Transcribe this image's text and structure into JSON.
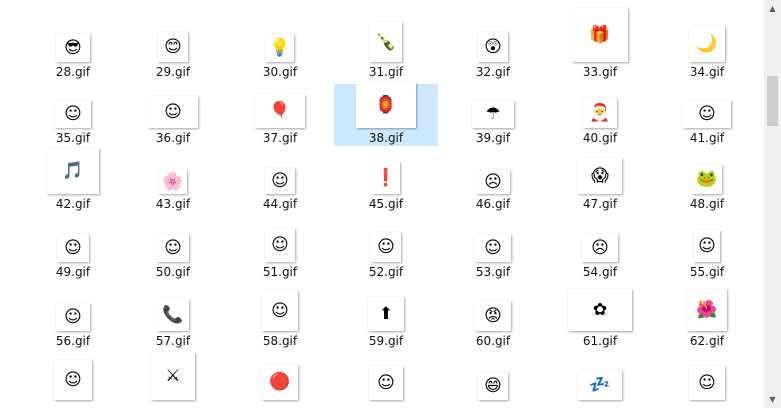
{
  "files": [
    {
      "name": "28.gif",
      "icon": "sunglasses-face",
      "glyph": "😎",
      "bg": "#ffffff"
    },
    {
      "name": "29.gif",
      "icon": "blush-face",
      "glyph": "😊",
      "bg": "#ffffff"
    },
    {
      "name": "30.gif",
      "icon": "lightbulb",
      "glyph": "💡",
      "bg": "#ffffff"
    },
    {
      "name": "31.gif",
      "icon": "bottle",
      "glyph": "🍾",
      "bg": "#ffffff"
    },
    {
      "name": "32.gif",
      "icon": "surprised-face",
      "glyph": "😲",
      "bg": "#ffffff"
    },
    {
      "name": "33.gif",
      "icon": "gift-box",
      "glyph": "🎁",
      "bg": "#ffffff"
    },
    {
      "name": "34.gif",
      "icon": "moon",
      "glyph": "🌙",
      "bg": "#ffffff"
    },
    {
      "name": "35.gif",
      "icon": "white-blob",
      "glyph": "☺",
      "bg": "#ffffff"
    },
    {
      "name": "36.gif",
      "icon": "thinking-blob",
      "glyph": "☺",
      "bg": "#ffffff"
    },
    {
      "name": "37.gif",
      "icon": "balloon-blob",
      "glyph": "🎈",
      "bg": "#ffffff"
    },
    {
      "name": "38.gif",
      "icon": "couplet-blob",
      "glyph": "🏮",
      "bg": "#ffffff"
    },
    {
      "name": "39.gif",
      "icon": "umbrella-blob",
      "glyph": "☂",
      "bg": "#ffffff"
    },
    {
      "name": "40.gif",
      "icon": "santa-blob",
      "glyph": "🎅",
      "bg": "#ffffff"
    },
    {
      "name": "41.gif",
      "icon": "green-hat-blob",
      "glyph": "☺",
      "bg": "#ffffff"
    },
    {
      "name": "42.gif",
      "icon": "music-blob",
      "glyph": "🎵",
      "bg": "#ffffff"
    },
    {
      "name": "43.gif",
      "icon": "flower-blob",
      "glyph": "🌸",
      "bg": "#ffffff"
    },
    {
      "name": "44.gif",
      "icon": "red-blob",
      "glyph": "☺",
      "bg": "#ffffff"
    },
    {
      "name": "45.gif",
      "icon": "exclaim-blob",
      "glyph": "❗",
      "bg": "#ffffff"
    },
    {
      "name": "46.gif",
      "icon": "crying-blob",
      "glyph": "☹",
      "bg": "#ffffff"
    },
    {
      "name": "47.gif",
      "icon": "shock-blob",
      "glyph": "😱",
      "bg": "#ffffff"
    },
    {
      "name": "48.gif",
      "icon": "green-blob",
      "glyph": "🐸",
      "bg": "#ffffff"
    },
    {
      "name": "49.gif",
      "icon": "blob",
      "glyph": "☺",
      "bg": "#ffffff"
    },
    {
      "name": "50.gif",
      "icon": "blob",
      "glyph": "☺",
      "bg": "#ffffff"
    },
    {
      "name": "51.gif",
      "icon": "blob",
      "glyph": "☺",
      "bg": "#ffffff"
    },
    {
      "name": "52.gif",
      "icon": "blob",
      "glyph": "☺",
      "bg": "#ffffff"
    },
    {
      "name": "53.gif",
      "icon": "blob",
      "glyph": "☺",
      "bg": "#ffffff"
    },
    {
      "name": "54.gif",
      "icon": "angry-blob",
      "glyph": "☹",
      "bg": "#ffffff"
    },
    {
      "name": "55.gif",
      "icon": "blob",
      "glyph": "☺",
      "bg": "#ffffff"
    },
    {
      "name": "56.gif",
      "icon": "blob",
      "glyph": "☺",
      "bg": "#ffffff"
    },
    {
      "name": "57.gif",
      "icon": "call-blob",
      "glyph": "📞",
      "bg": "#ffffff"
    },
    {
      "name": "58.gif",
      "icon": "blob",
      "glyph": "☺",
      "bg": "#ffffff"
    },
    {
      "name": "59.gif",
      "icon": "arrow-blob",
      "glyph": "⬆",
      "bg": "#ffffff"
    },
    {
      "name": "60.gif",
      "icon": "red-angry-blob",
      "glyph": "😡",
      "bg": "#ffffff"
    },
    {
      "name": "61.gif",
      "icon": "pink-blob",
      "glyph": "✿",
      "bg": "#ffffff"
    },
    {
      "name": "62.gif",
      "icon": "pink-flower-blob",
      "glyph": "🌺",
      "bg": "#ffffff"
    },
    {
      "name": "",
      "icon": "blob",
      "glyph": "☺",
      "bg": "#ffffff"
    },
    {
      "name": "",
      "icon": "sword-blob",
      "glyph": "⚔",
      "bg": "#ffffff"
    },
    {
      "name": "",
      "icon": "red-ball",
      "glyph": "🔴",
      "bg": "#ffffff"
    },
    {
      "name": "",
      "icon": "blob",
      "glyph": "☺",
      "bg": "#ffffff"
    },
    {
      "name": "",
      "icon": "yellow-face",
      "glyph": "😄",
      "bg": "#ffffff"
    },
    {
      "name": "",
      "icon": "sleepy-blob",
      "glyph": "💤",
      "bg": "#ffffff"
    },
    {
      "name": "",
      "icon": "desk-blob",
      "glyph": "☺",
      "bg": "#ffffff"
    }
  ],
  "selected_file": "38.gif",
  "colors": {
    "selection": "#cce8ff",
    "scrollbar": "#f0f0f0",
    "scroll_thumb": "#cdcdcd"
  },
  "scrollbar": {
    "up_icon": "chevron-up-icon",
    "down_icon": "chevron-down-icon"
  }
}
